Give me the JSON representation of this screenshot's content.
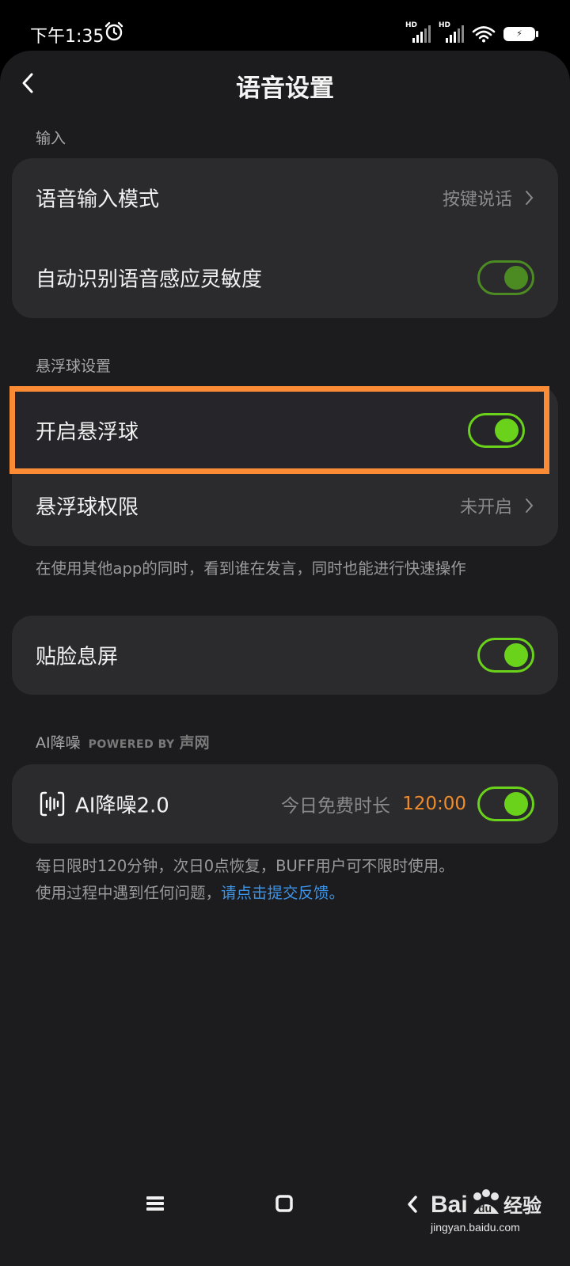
{
  "status_bar": {
    "time": "下午1:35",
    "signal_badge_1": "HD",
    "signal_badge_2": "HD",
    "battery_label": "⚡"
  },
  "header": {
    "title": "语音设置"
  },
  "sections": {
    "input": {
      "header": "输入",
      "voice_input_mode_label": "语音输入模式",
      "voice_input_mode_value": "按键说话",
      "auto_sensitivity_label": "自动识别语音感应灵敏度",
      "auto_sensitivity_on": true
    },
    "floating_ball": {
      "header": "悬浮球设置",
      "enable_label": "开启悬浮球",
      "enable_on": true,
      "permission_label": "悬浮球权限",
      "permission_value": "未开启",
      "note": "在使用其他app的同时，看到谁在发言，同时也能进行快速操作"
    },
    "face_screen": {
      "label": "贴脸息屏",
      "on": true
    },
    "ai_noise": {
      "header": "AI降噪",
      "powered_by": "POWERED BY",
      "powered_brand": "声网",
      "label": "AI降噪2.0",
      "free_label": "今日免费时长",
      "free_time": "120:00",
      "on": true,
      "note_line1": "每日限时120分钟，次日0点恢复，BUFF用户可不限时使用。",
      "note_line2_prefix": "使用过程中遇到任何问题，",
      "note_line2_link": "请点击提交反馈。"
    }
  },
  "watermark": {
    "brand": "Baidu",
    "brand_cn": "经验",
    "url": "jingyan.baidu.com"
  },
  "colors": {
    "toggle_active": "#6ad21a",
    "highlight_border": "#fb8b35",
    "link": "#3d93e6",
    "time_accent": "#f08c2a"
  }
}
